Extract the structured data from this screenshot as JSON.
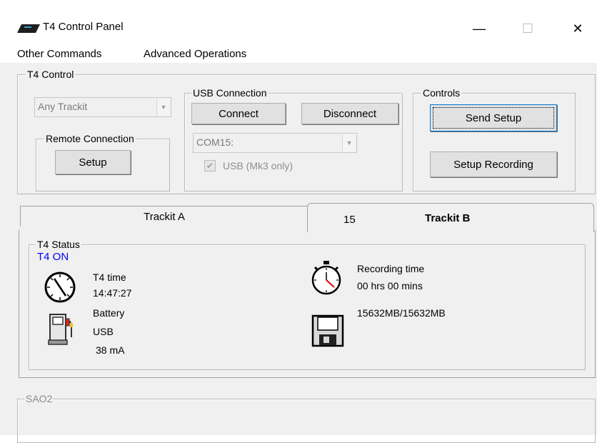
{
  "window": {
    "title": "T4 Control Panel",
    "minimize_glyph": "—",
    "maximize_glyph": "☐",
    "close_glyph": "✕"
  },
  "menu": {
    "items": [
      "Other Commands",
      "Advanced Operations"
    ]
  },
  "t4_control": {
    "label": "T4 Control",
    "trackit_select": {
      "value": "Any Trackit"
    },
    "remote_connection": {
      "label": "Remote Connection",
      "setup_button": "Setup"
    },
    "usb_connection": {
      "label": "USB Connection",
      "connect_button": "Connect",
      "disconnect_button": "Disconnect",
      "port_select": {
        "value": "COM15:"
      },
      "usb_checkbox": {
        "label": "USB (Mk3 only)",
        "checked": true
      }
    },
    "controls": {
      "label": "Controls",
      "send_setup_button": "Send Setup",
      "setup_recording_button": "Setup Recording"
    }
  },
  "tabs": [
    {
      "label": "Trackit A",
      "active": false
    },
    {
      "number": "15",
      "label": "Trackit B",
      "active": true
    }
  ],
  "t4_status": {
    "label": "T4 Status",
    "state": "T4 ON",
    "time_label": "T4 time",
    "time_value": "14:47:27",
    "battery_label": "Battery",
    "battery_source": "USB",
    "battery_current": "38 mA",
    "recording_label": "Recording time",
    "recording_value": "00 hrs 00 mins",
    "storage": "15632MB/15632MB"
  },
  "sao2": {
    "label": "SAO2"
  },
  "colors": {
    "status_on": "#0000ff",
    "panel_bg": "#f0f0f0",
    "button_bg": "#e1e1e1"
  }
}
